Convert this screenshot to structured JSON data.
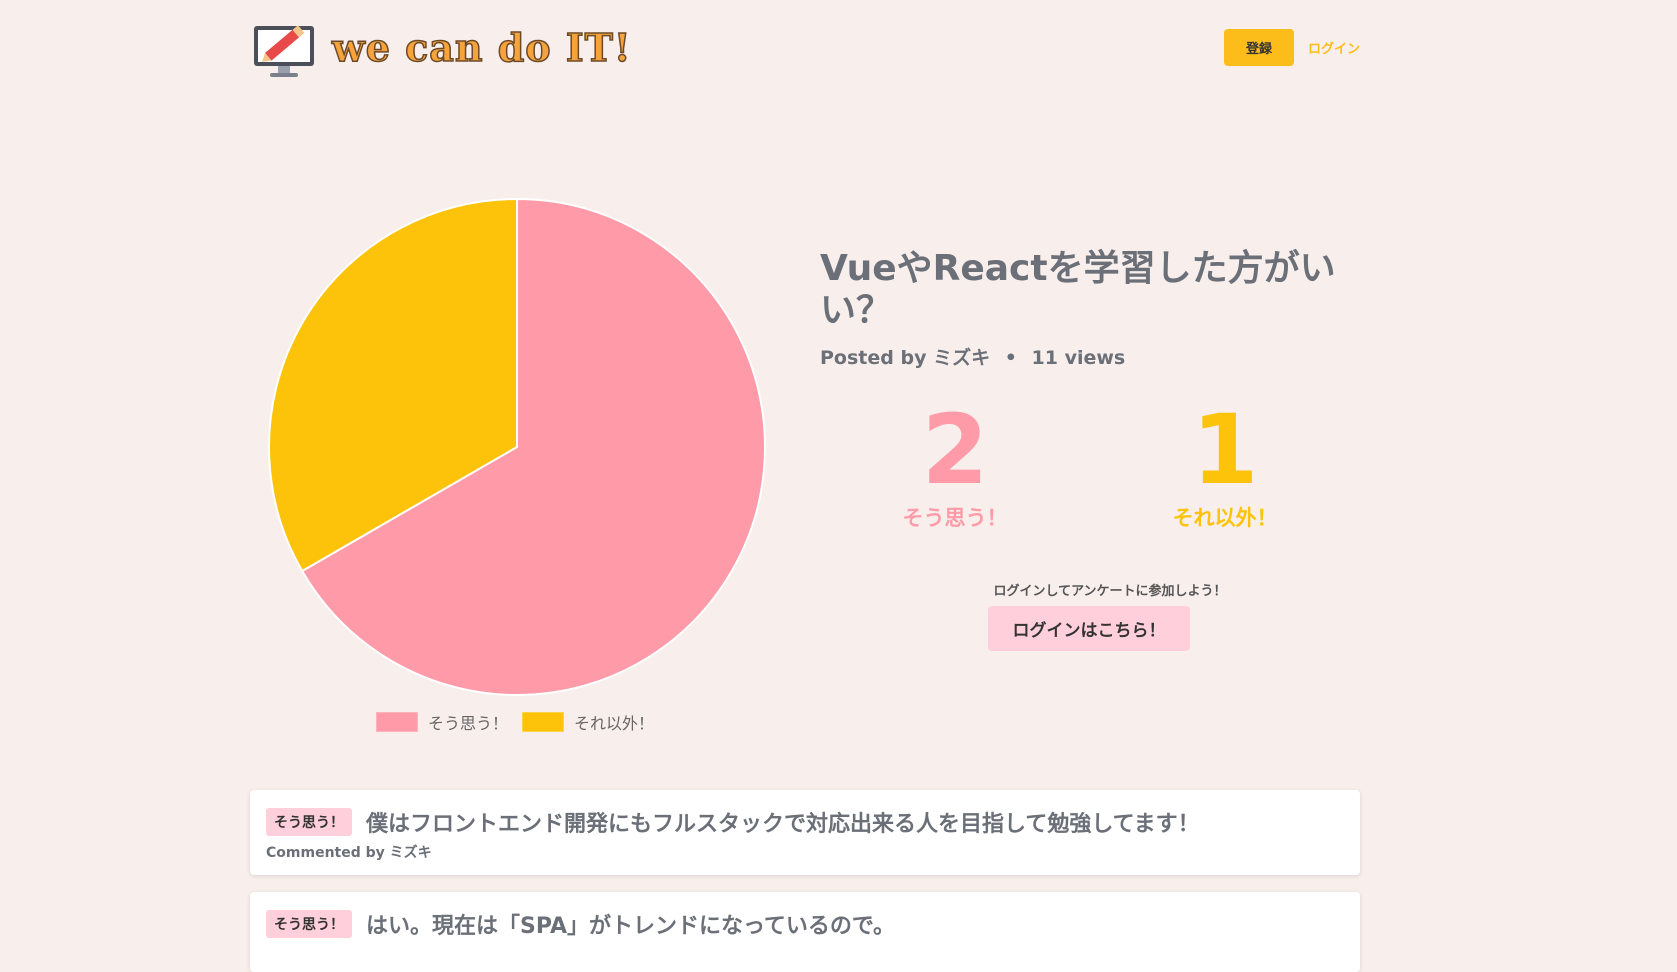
{
  "header": {
    "logo_text": "we can do IT!",
    "register_label": "登録",
    "login_label": "ログイン"
  },
  "poll": {
    "title": "VueやReactを学習した方がいい？",
    "posted_by_prefix": "Posted by",
    "author": "ミズキ",
    "views": "11 views",
    "yes_count": "2",
    "yes_label": "そう思う！",
    "no_count": "1",
    "no_label": "それ以外！",
    "login_prompt": "ログインしてアンケートに参加しよう！",
    "login_button": "ログインはこちら！"
  },
  "chart_data": {
    "type": "pie",
    "categories": [
      "そう思う！",
      "それ以外！"
    ],
    "values": [
      2,
      1
    ],
    "colors": [
      "#ff9ba8",
      "#fcc30a"
    ],
    "legend": "bottom"
  },
  "comments": [
    {
      "tag": "そう思う！",
      "text": "僕はフロントエンド開発にもフルスタックで対応出来る人を目指して勉強してます！",
      "by": "Commented by ミズキ"
    },
    {
      "tag": "そう思う！",
      "text": "はい。現在は「SPA」がトレンドになっているので。",
      "by": ""
    }
  ],
  "colors": {
    "background": "#f8eeec",
    "accent_yellow": "#fcbd1a",
    "accent_pink": "#ff9ba8",
    "tag_pink": "#ffd0dc"
  }
}
